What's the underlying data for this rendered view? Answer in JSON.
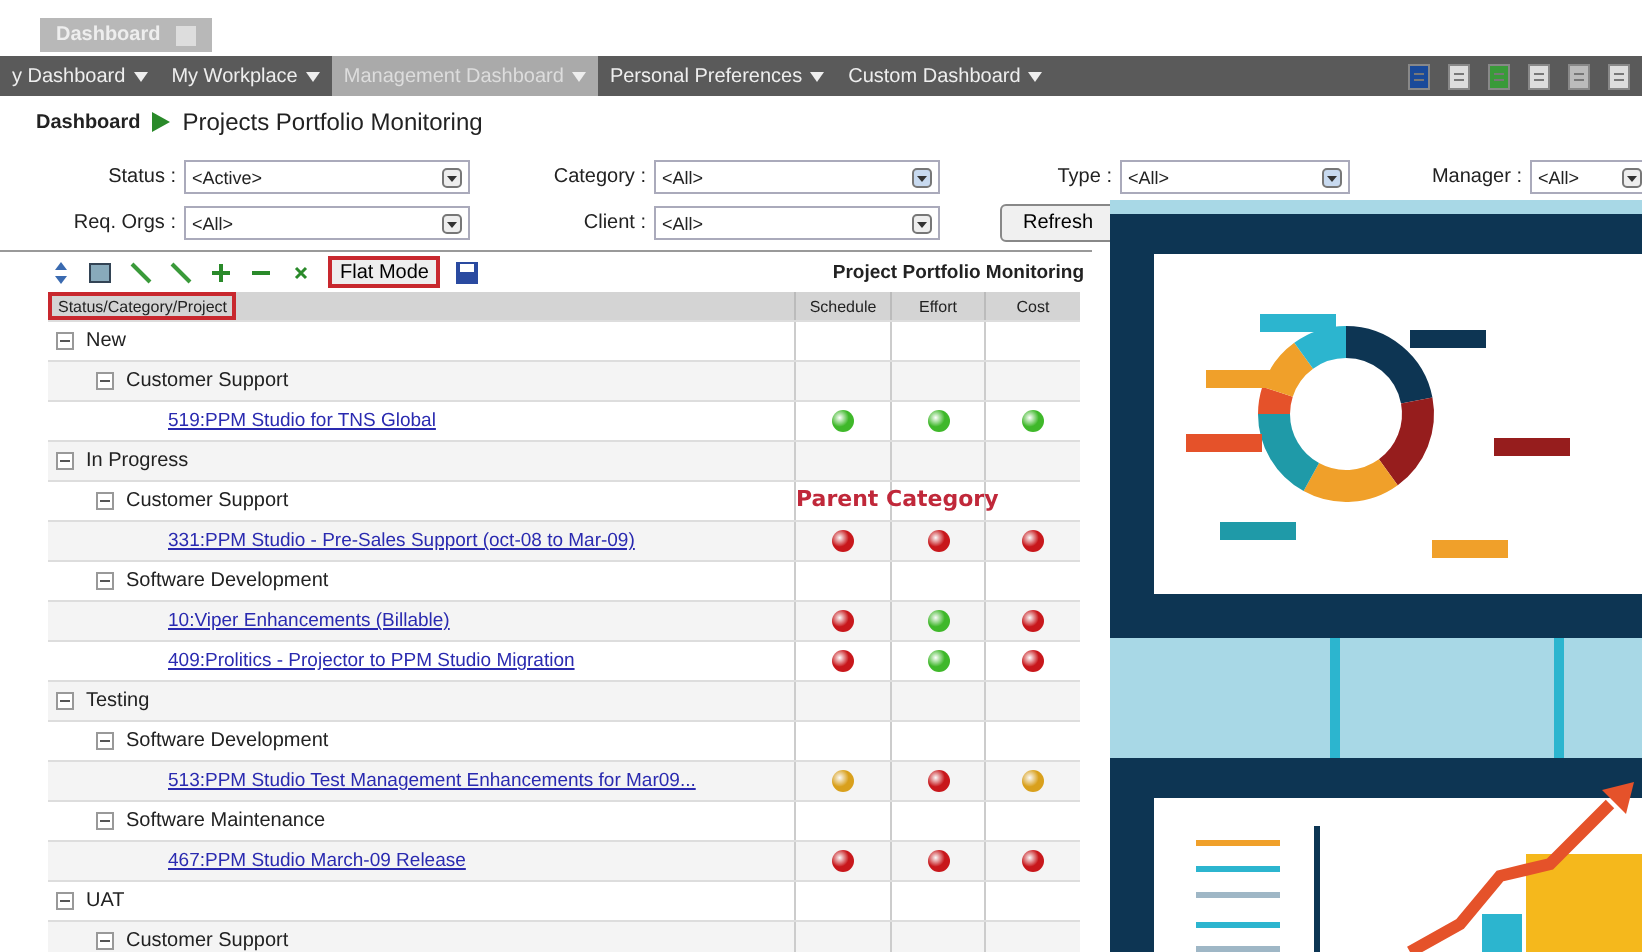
{
  "window_tab": {
    "title": "Dashboard"
  },
  "menu": [
    {
      "label": "y Dashboard",
      "selected": false
    },
    {
      "label": "My Workplace",
      "selected": false
    },
    {
      "label": "Management Dashboard",
      "selected": true
    },
    {
      "label": "Personal Preferences",
      "selected": false
    },
    {
      "label": "Custom Dashboard",
      "selected": false
    }
  ],
  "breadcrumb": {
    "root": "Dashboard",
    "page": "Projects Portfolio Monitoring"
  },
  "filters": [
    {
      "label": "Status :",
      "value": "<Active>"
    },
    {
      "label": "Category :",
      "value": "<All>"
    },
    {
      "label": "Type :",
      "value": "<All>"
    },
    {
      "label": "Manager :",
      "value": "<All>"
    },
    {
      "label": "Req. Orgs :",
      "value": "<All>"
    },
    {
      "label": "Client :",
      "value": "<All>"
    }
  ],
  "refresh_button": "Refresh",
  "toolbar": {
    "flat_mode": "Flat Mode",
    "grid_title": "Project Portfolio Monitoring"
  },
  "columns": [
    "Status/Category/Project",
    "Schedule",
    "Effort",
    "Cost"
  ],
  "tree": [
    {
      "label": "New",
      "expanded": true,
      "children": [
        {
          "label": "Customer Support",
          "expanded": true,
          "children": [
            {
              "label": "519:PPM Studio for TNS Global",
              "indicators": [
                {
                  "color": "#3fb82a"
                },
                {
                  "color": "#3fb82a"
                },
                {
                  "color": "#3fb82a"
                }
              ]
            }
          ]
        }
      ]
    },
    {
      "label": "In Progress",
      "expanded": true,
      "children": [
        {
          "label": "Customer Support",
          "expanded": true,
          "note": "Parent Category",
          "children": [
            {
              "label": "331:PPM Studio - Pre-Sales Support (oct-08 to Mar-09)",
              "indicators": [
                {
                  "color": "#c8171b"
                },
                {
                  "color": "#c8171b"
                },
                {
                  "color": "#c8171b"
                }
              ]
            }
          ]
        },
        {
          "label": "Software Development",
          "expanded": true,
          "children": [
            {
              "label": "10:Viper Enhancements (Billable)",
              "indicators": [
                {
                  "color": "#c8171b"
                },
                {
                  "color": "#3fb82a"
                },
                {
                  "color": "#c8171b"
                }
              ]
            },
            {
              "label": "409:Prolitics - Projector to PPM Studio Migration",
              "indicators": [
                {
                  "color": "#c8171b"
                },
                {
                  "color": "#3fb82a"
                },
                {
                  "color": "#c8171b"
                }
              ]
            }
          ]
        }
      ]
    },
    {
      "label": "Testing",
      "expanded": true,
      "children": [
        {
          "label": "Software Development",
          "expanded": true,
          "children": [
            {
              "label": "513:PPM Studio Test Management Enhancements for Mar09...",
              "indicators": [
                {
                  "color": "#d9a01c"
                },
                {
                  "color": "#c8171b"
                },
                {
                  "color": "#d9a01c"
                }
              ]
            }
          ]
        },
        {
          "label": "Software Maintenance",
          "expanded": true,
          "children": [
            {
              "label": "467:PPM Studio March-09 Release",
              "indicators": [
                {
                  "color": "#c8171b"
                },
                {
                  "color": "#c8171b"
                },
                {
                  "color": "#c8171b"
                }
              ]
            }
          ]
        }
      ]
    },
    {
      "label": "UAT",
      "expanded": true,
      "children": [
        {
          "label": "Customer Support",
          "expanded": true
        }
      ]
    }
  ]
}
